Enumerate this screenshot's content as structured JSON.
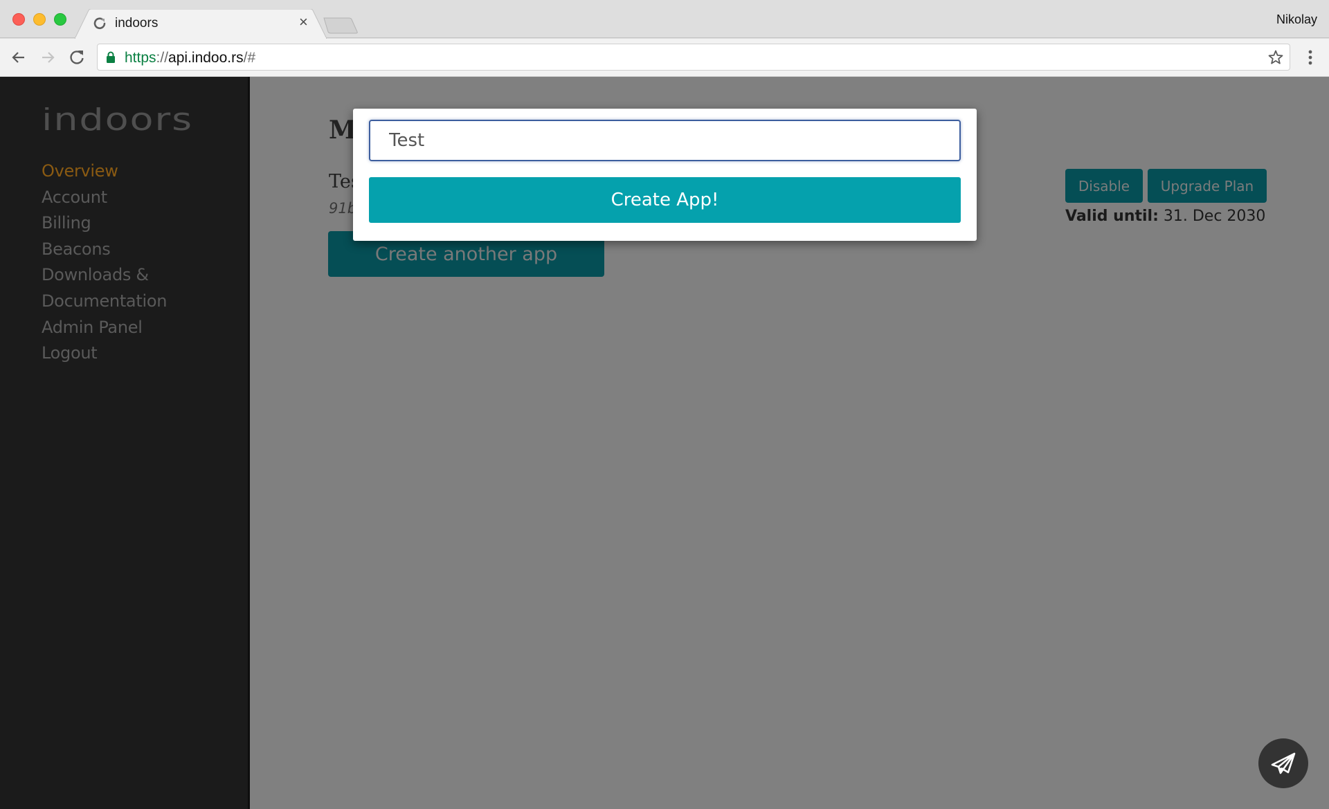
{
  "browser": {
    "tab_title": "indoors",
    "tab_close_glyph": "×",
    "profile_name": "Nikolay",
    "url": {
      "scheme": "https",
      "separator": "://",
      "host": "api.indoo.rs",
      "path": "/#"
    },
    "icons": {
      "back": "arrow-left-icon",
      "forward": "arrow-right-icon",
      "reload": "reload-icon",
      "secure": "lock-icon",
      "bookmark": "star-icon",
      "menu": "more-vertical-icon",
      "favicon": "loading-favicon-icon"
    }
  },
  "sidebar": {
    "logo_text": "indoors",
    "items": [
      {
        "label": "Overview",
        "active": true
      },
      {
        "label": "Account",
        "active": false
      },
      {
        "label": "Billing",
        "active": false
      },
      {
        "label": "Beacons",
        "active": false
      },
      {
        "label": "Downloads &",
        "active": false
      },
      {
        "label": "Documentation",
        "active": false
      },
      {
        "label": "Admin Panel",
        "active": false
      },
      {
        "label": "Logout",
        "active": false
      }
    ]
  },
  "main": {
    "page_title": "My Apps",
    "app_name": "Test",
    "app_key": "91b",
    "create_another_label": "Create another app",
    "disable_label": "Disable",
    "upgrade_label": "Upgrade Plan",
    "valid_until_label": "Valid until:",
    "valid_until_value": "31. Dec 2030"
  },
  "modal": {
    "input_value": "Test",
    "submit_label": "Create App!"
  },
  "fab": {
    "icon": "paper-plane-icon"
  },
  "colors": {
    "accent_teal": "#05a1ad",
    "active_nav": "#8a5a12",
    "sidebar_bg": "#1b1b1b",
    "overlay": "#808080"
  }
}
